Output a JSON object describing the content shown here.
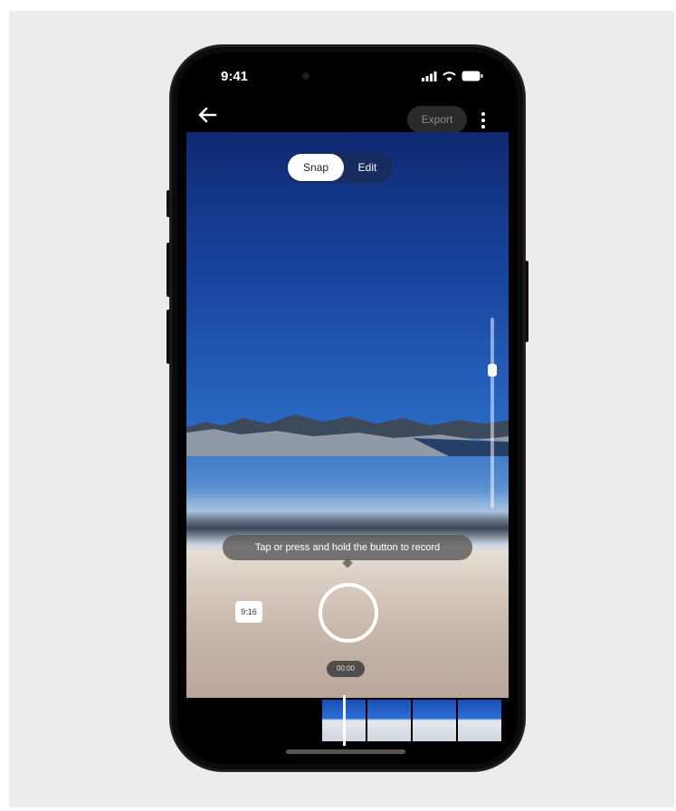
{
  "status_bar": {
    "time": "9:41"
  },
  "toolbar": {
    "export_label": "Export"
  },
  "mode_toggle": {
    "snap_label": "Snap",
    "edit_label": "Edit"
  },
  "hint": {
    "text": "Tap or press and hold the button to record"
  },
  "controls": {
    "aspect_ratio_label": "9:16",
    "timer_label": "00:00"
  },
  "icons": [
    "back-arrow-icon",
    "signal-icon",
    "wifi-icon",
    "battery-icon",
    "more-vertical-icon"
  ]
}
